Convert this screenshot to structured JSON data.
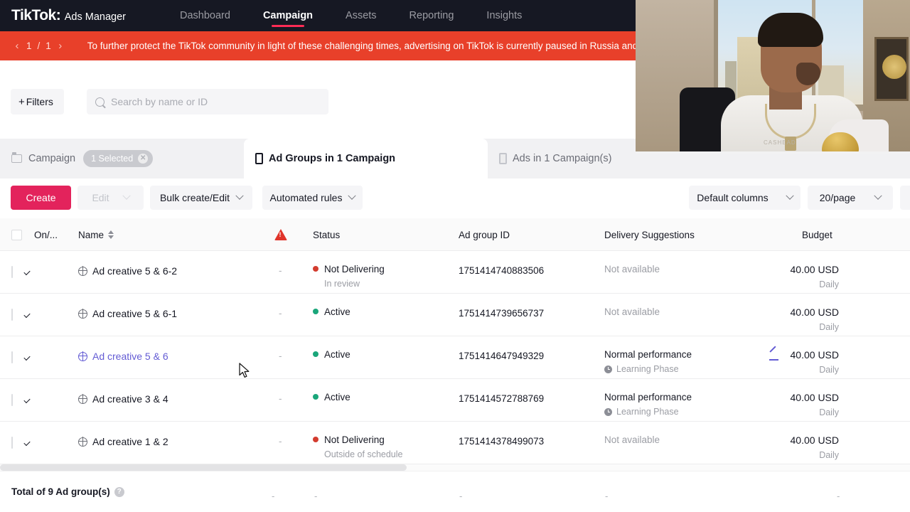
{
  "topnav": {
    "brand_name": "TikTok",
    "brand_colon": ":",
    "brand_sub": "Ads Manager",
    "items": [
      {
        "label": "Dashboard",
        "active": false
      },
      {
        "label": "Campaign",
        "active": true
      },
      {
        "label": "Assets",
        "active": false
      },
      {
        "label": "Reporting",
        "active": false
      },
      {
        "label": "Insights",
        "active": false
      }
    ]
  },
  "banner": {
    "prev_icon": "‹",
    "next_icon": "›",
    "current_page": "1",
    "separator": "/",
    "total_pages": "1",
    "text": "To further protect the TikTok community in light of these challenging times, advertising on TikTok is currently paused in Russia and Ukr",
    "bg_color": "#e8402a"
  },
  "filterbar": {
    "filters_label": "Filters",
    "filters_plus": "+",
    "search_placeholder": "Search by name or ID",
    "search_value": ""
  },
  "level_tabs": [
    {
      "label": "Campaign",
      "icon": "folder-icon",
      "active": false,
      "chip": "1 Selected"
    },
    {
      "label": "Ad Groups in 1 Campaign",
      "icon": "phone-icon",
      "active": true
    },
    {
      "label": "Ads in 1 Campaign(s)",
      "icon": "phone-icon",
      "active": false
    }
  ],
  "toolbar": {
    "create_label": "Create",
    "edit_label": "Edit",
    "bulk_label": "Bulk create/Edit",
    "automated_label": "Automated rules",
    "columns_label": "Default columns",
    "page_size_label": "20/page",
    "create_color": "#e3235c"
  },
  "table": {
    "headers": {
      "onoff": "On/...",
      "name": "Name",
      "warning": "warning-icon",
      "status": "Status",
      "ad_group_id": "Ad group ID",
      "delivery": "Delivery Suggestions",
      "budget": "Budget"
    },
    "rows": [
      {
        "enabled": true,
        "name": "Ad creative 5 & 6-2",
        "visited": false,
        "warn": "-",
        "status": "Not Delivering",
        "status_color": "red",
        "status_sub": "In review",
        "ad_group_id": "1751414740883506",
        "delivery": "Not available",
        "delivery_available": false,
        "delivery_sub": "",
        "budget": "40.00 USD",
        "budget_sub": "Daily",
        "has_edit_icon": false
      },
      {
        "enabled": true,
        "name": "Ad creative 5 & 6-1",
        "visited": false,
        "warn": "-",
        "status": "Active",
        "status_color": "green",
        "status_sub": "",
        "ad_group_id": "1751414739656737",
        "delivery": "Not available",
        "delivery_available": false,
        "delivery_sub": "",
        "budget": "40.00 USD",
        "budget_sub": "Daily",
        "has_edit_icon": false
      },
      {
        "enabled": true,
        "name": "Ad creative 5 & 6",
        "visited": true,
        "warn": "-",
        "status": "Active",
        "status_color": "green",
        "status_sub": "",
        "ad_group_id": "1751414647949329",
        "delivery": "Normal performance",
        "delivery_available": true,
        "delivery_sub": "Learning Phase",
        "budget": "40.00 USD",
        "budget_sub": "Daily",
        "has_edit_icon": true
      },
      {
        "enabled": true,
        "name": "Ad creative 3 & 4",
        "visited": false,
        "warn": "-",
        "status": "Active",
        "status_color": "green",
        "status_sub": "",
        "ad_group_id": "1751414572788769",
        "delivery": "Normal performance",
        "delivery_available": true,
        "delivery_sub": "Learning Phase",
        "budget": "40.00 USD",
        "budget_sub": "Daily",
        "has_edit_icon": false
      },
      {
        "enabled": true,
        "name": "Ad creative 1 & 2",
        "visited": false,
        "warn": "-",
        "status": "Not Delivering",
        "status_color": "red",
        "status_sub": "Outside of schedule",
        "ad_group_id": "1751414378499073",
        "delivery": "Not available",
        "delivery_available": false,
        "delivery_sub": "",
        "budget": "40.00 USD",
        "budget_sub": "Daily",
        "has_edit_icon": false
      }
    ]
  },
  "footer": {
    "total_label": "Total of 9 Ad group(s)",
    "help_icon": "?",
    "dashes": [
      "-",
      "-",
      "-",
      "-",
      "-"
    ]
  },
  "overlay": {
    "type": "webcam-video",
    "shirt_text": "CASHEAD"
  }
}
